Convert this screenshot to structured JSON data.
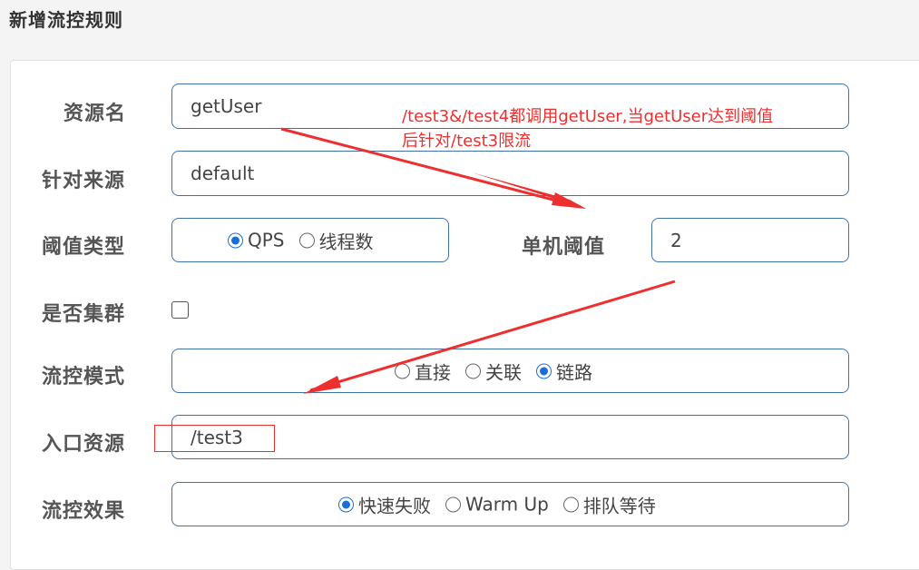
{
  "header": {
    "title": "新增流控规则"
  },
  "form": {
    "resource_name": {
      "label": "资源名",
      "value": "getUser"
    },
    "limit_app": {
      "label": "针对来源",
      "value": "default"
    },
    "grade": {
      "label": "阈值类型",
      "options": [
        {
          "label": "QPS",
          "checked": true
        },
        {
          "label": "线程数",
          "checked": false
        }
      ]
    },
    "count": {
      "label": "单机阈值",
      "value": "2"
    },
    "cluster": {
      "label": "是否集群",
      "checked": false
    },
    "strategy": {
      "label": "流控模式",
      "options": [
        {
          "label": "直接",
          "checked": false
        },
        {
          "label": "关联",
          "checked": false
        },
        {
          "label": "链路",
          "checked": true
        }
      ]
    },
    "ref_resource": {
      "label": "入口资源",
      "value": "/test3"
    },
    "control_behavior": {
      "label": "流控效果",
      "options": [
        {
          "label": "快速失败",
          "checked": true
        },
        {
          "label": "Warm Up",
          "checked": false
        },
        {
          "label": "排队等待",
          "checked": false
        }
      ]
    }
  },
  "annotation": {
    "line1": "/test3&/test4都调用getUser,当getUser达到阈值",
    "line2": "后针对/test3限流",
    "color": "#ee2f2f"
  },
  "colors": {
    "input_border": "#3f73a8",
    "radio_checked": "#1a6fd6"
  }
}
